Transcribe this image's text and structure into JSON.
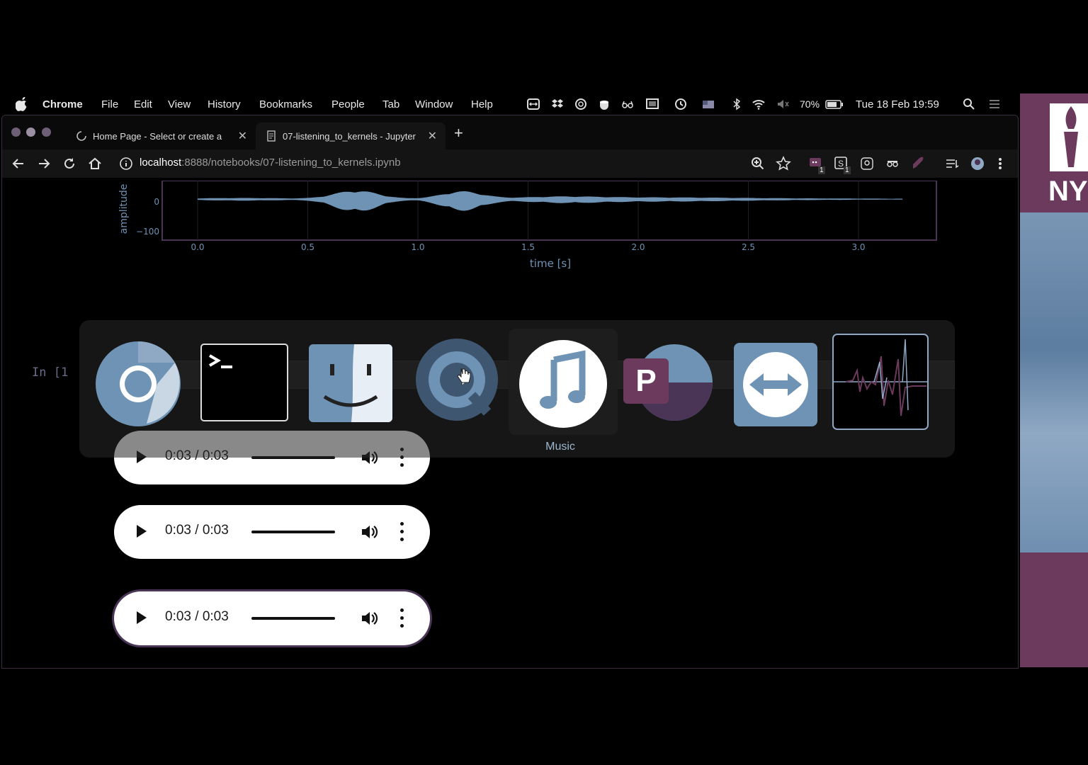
{
  "menubar": {
    "app_name": "Chrome",
    "menus": [
      "File",
      "Edit",
      "View",
      "History",
      "Bookmarks",
      "People",
      "Tab",
      "Window",
      "Help"
    ],
    "battery": "70%",
    "clock": "Tue 18 Feb  19:59"
  },
  "browser": {
    "tabs": [
      {
        "title": "Home Page - Select or create a",
        "active": false,
        "loading": true
      },
      {
        "title": "07-listening_to_kernels - Jupyter",
        "active": true,
        "loading": false
      }
    ],
    "new_tab": "+",
    "url": {
      "host": "localhost",
      "path": ":8888/notebooks/07-listening_to_kernels.ipynb"
    },
    "extension_badges": [
      "1",
      "1"
    ]
  },
  "notebook": {
    "cell_prompt": "In [1",
    "plot": {
      "ylabel": "amplitude",
      "xlabel": "time [s]",
      "yticks": [
        "0",
        "−100"
      ],
      "xticks": [
        "0.0",
        "0.5",
        "1.0",
        "1.5",
        "2.0",
        "2.5",
        "3.0"
      ]
    },
    "audio_players": [
      {
        "time": "0:03 / 0:03",
        "focused": false
      },
      {
        "time": "0:03 / 0:03",
        "focused": false
      },
      {
        "time": "0:03 / 0:03",
        "focused": true
      }
    ]
  },
  "app_switcher": {
    "apps": [
      {
        "name": "chrome-icon"
      },
      {
        "name": "terminal-icon"
      },
      {
        "name": "finder-icon"
      },
      {
        "name": "quicktime-icon"
      },
      {
        "name": "music-icon",
        "selected": true
      },
      {
        "name": "pdf-expert-icon"
      },
      {
        "name": "teamviewer-icon"
      },
      {
        "name": "audio-waveform-app-icon"
      }
    ],
    "selected_label": "Music"
  },
  "right_window": {
    "logo_text": "NY"
  },
  "colors": {
    "accent_purple": "#6b3a5c",
    "waveform": "#6f93b4",
    "highlight_blue": "#9fb6d0"
  }
}
